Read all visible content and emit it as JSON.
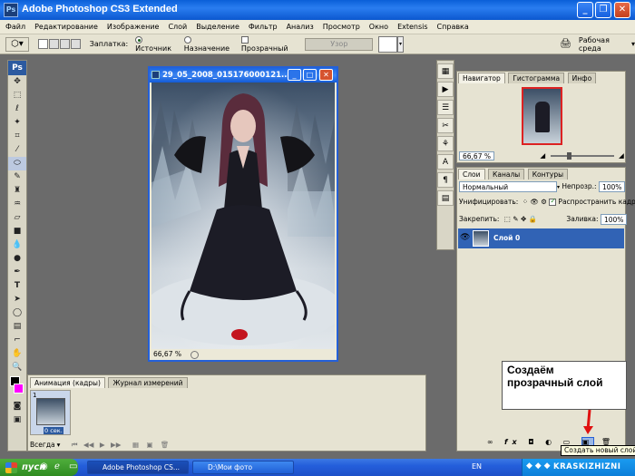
{
  "window": {
    "title": "Adobe Photoshop CS3 Extended",
    "app_icon": "Ps"
  },
  "menu": [
    "Файл",
    "Редактирование",
    "Изображение",
    "Слой",
    "Выделение",
    "Фильтр",
    "Анализ",
    "Просмотр",
    "Окно",
    "Extensis",
    "Справка"
  ],
  "options": {
    "patch_label": "Заплатка:",
    "source_label": "Источник",
    "dest_label": "Назначение",
    "transparent_label": "Прозрачный",
    "pattern_button": "Узор",
    "workspace_label": "Рабочая среда"
  },
  "toolbox": {
    "ps_label": "Ps"
  },
  "document": {
    "title": "29_05_2008_015176000121...",
    "zoom": "66,67 %"
  },
  "navigator": {
    "tabs": [
      "Навигатор",
      "Гистограмма",
      "Инфо"
    ],
    "zoom": "66,67 %"
  },
  "layers": {
    "tabs": [
      "Слои",
      "Каналы",
      "Контуры"
    ],
    "blend_mode": "Нормальный",
    "opacity_label": "Непрозр.:",
    "opacity_value": "100%",
    "unify_label": "Унифицировать:",
    "propagate_label": "Распространить кадр 1",
    "lock_label": "Закрепить:",
    "fill_label": "Заливка:",
    "fill_value": "100%",
    "layer_name": "Слой 0",
    "tooltip": "Создать новый слой"
  },
  "animation": {
    "tabs": [
      "Анимация (кадры)",
      "Журнал измерений"
    ],
    "frame_number": "1",
    "frame_time": "0 сек.",
    "loop": "Всегда"
  },
  "callout": {
    "text": "Создаём прозрачный слой"
  },
  "taskbar": {
    "start": "пуск",
    "items": [
      "Adobe Photoshop CS...",
      "D:\\Мои фото"
    ],
    "lang": "EN",
    "watermark": "KRASKIZHIZNI"
  },
  "colors": {
    "title_blue": "#0a5fd8",
    "selected_layer": "#3163b5",
    "foreground": "#000000",
    "background": "#ff00ff"
  }
}
